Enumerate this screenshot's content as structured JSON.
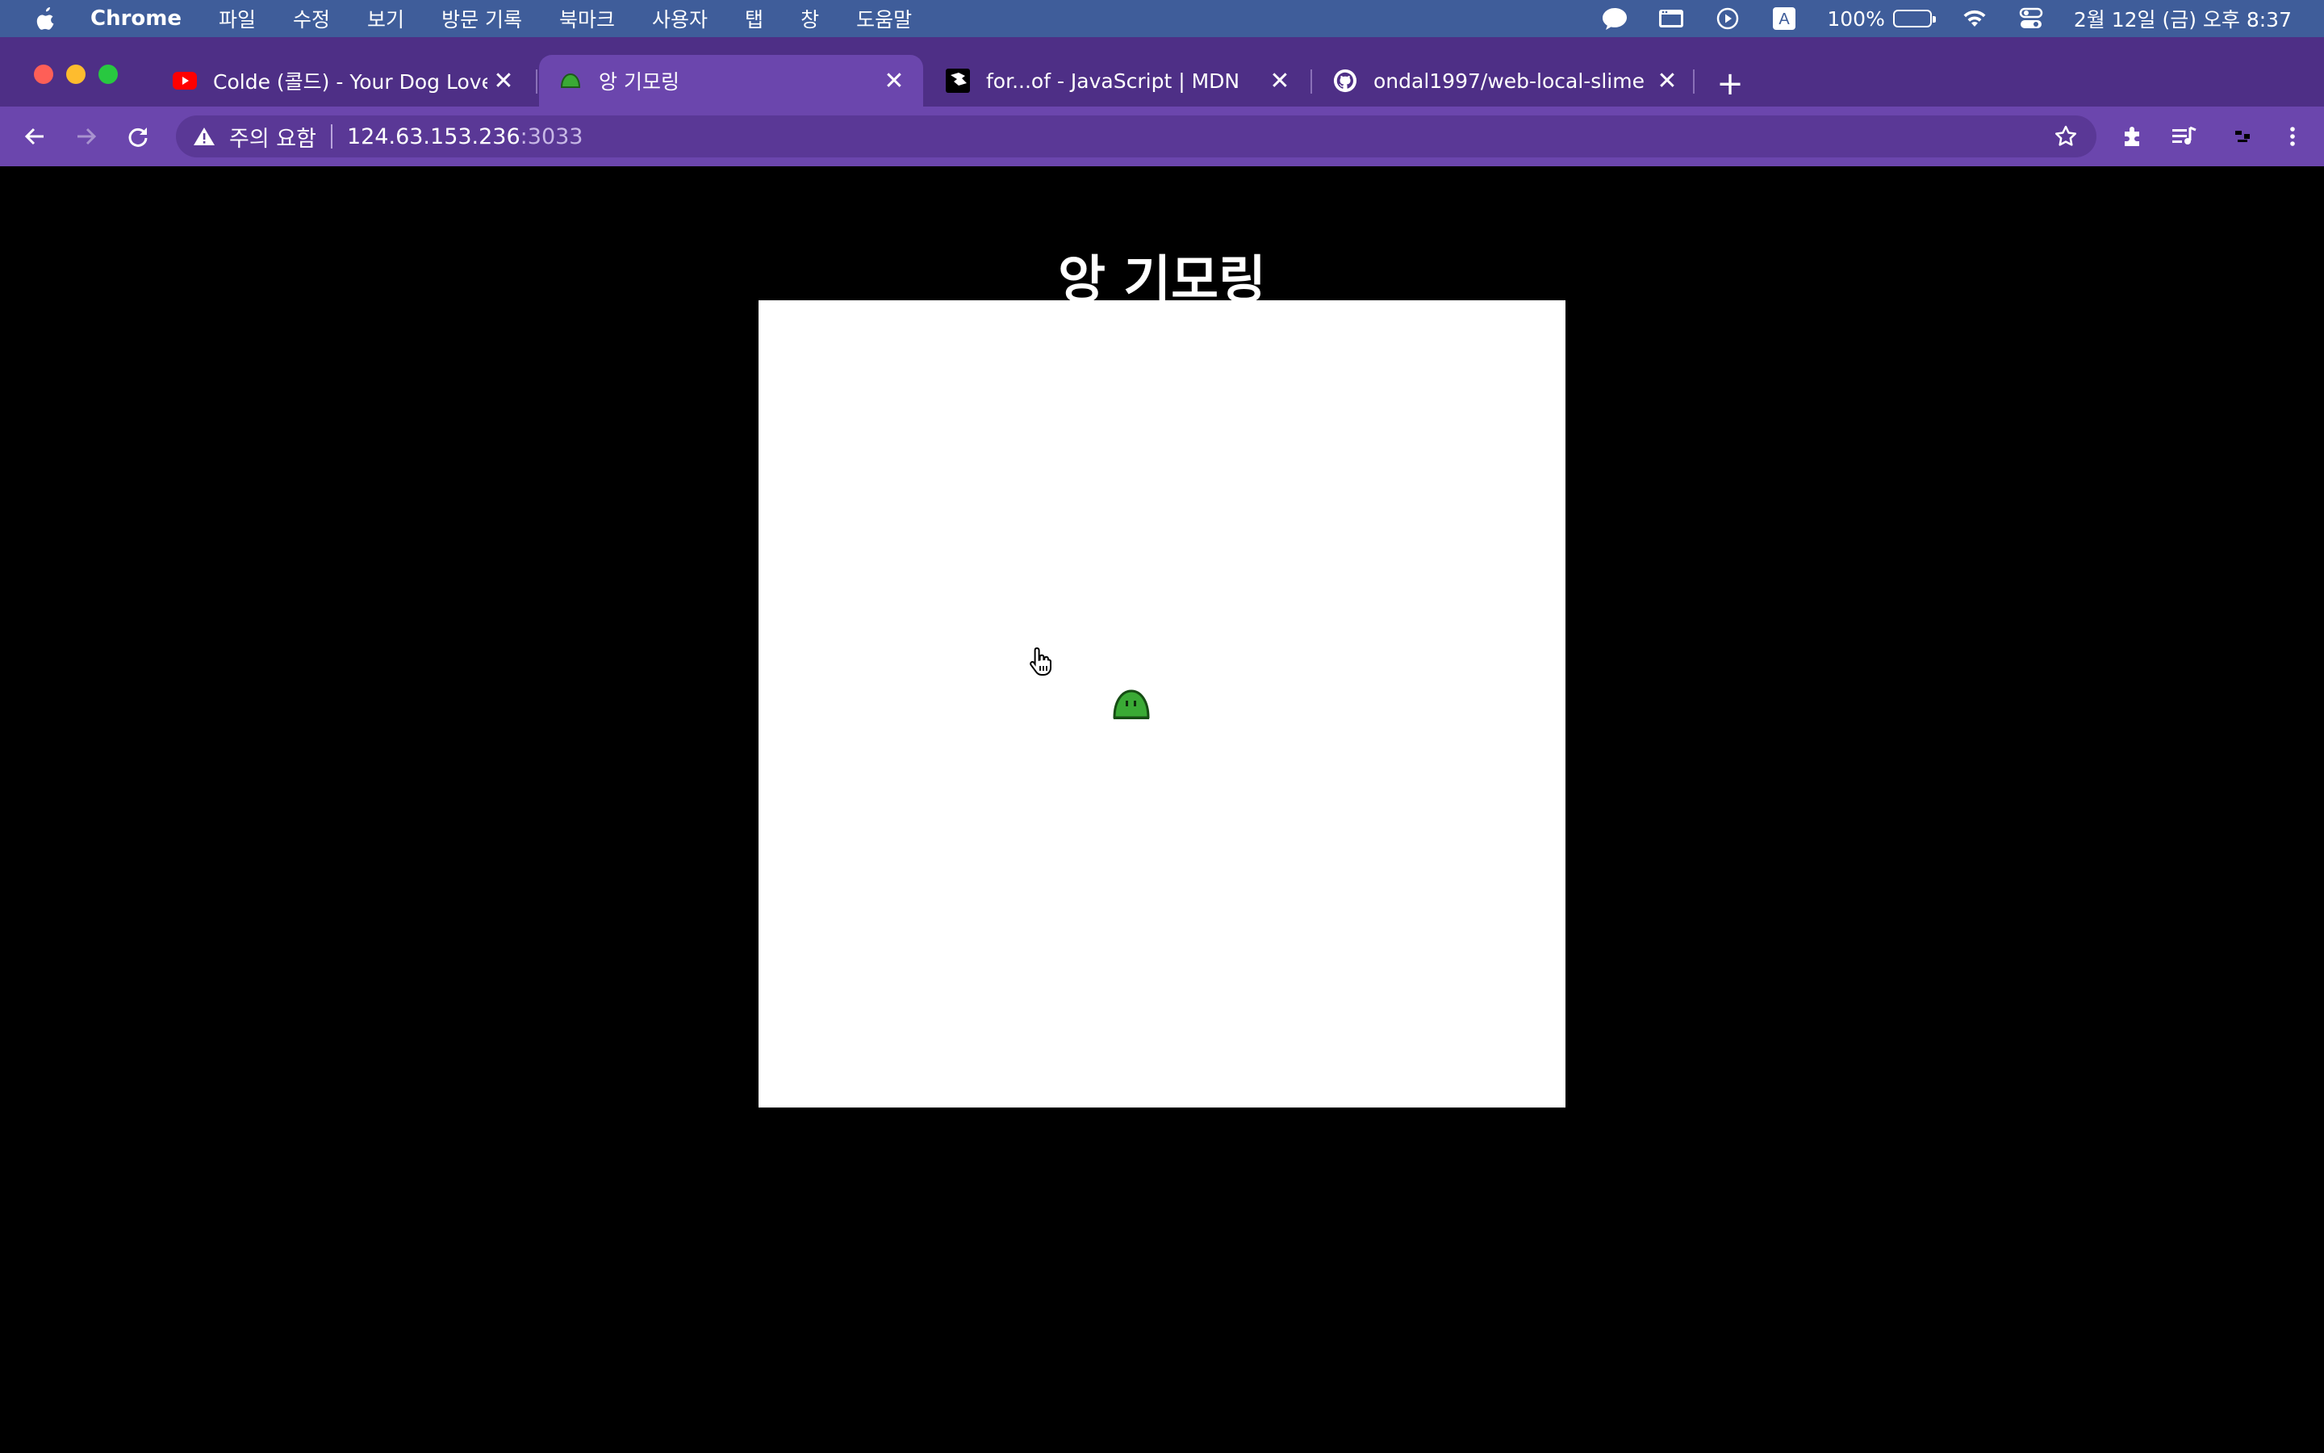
{
  "menubar": {
    "app_name": "Chrome",
    "menus": [
      "파일",
      "수정",
      "보기",
      "방문 기록",
      "북마크",
      "사용자",
      "탭",
      "창",
      "도움말"
    ],
    "battery_percent": "100%",
    "clock": "2월 12일 (금) 오후 8:37",
    "input_source": "A"
  },
  "tabs": [
    {
      "title": "Colde (콜드) - Your Dog Loves Y",
      "favicon": "youtube-icon",
      "active": false
    },
    {
      "title": "앙 기모링",
      "favicon": "slime-icon",
      "active": true
    },
    {
      "title": "for...of - JavaScript | MDN",
      "favicon": "mdn-icon",
      "active": false
    },
    {
      "title": "ondal1997/web-local-slime",
      "favicon": "github-icon",
      "active": false
    }
  ],
  "omnibox": {
    "security_label": "주의 요함",
    "host": "124.63.153.236",
    "port": ":3033"
  },
  "page": {
    "heading": "앙 기모링"
  },
  "colors": {
    "menubar": "#3f5d9a",
    "tabstrip": "#4e2f86",
    "toolbar": "#6b46ad",
    "slime": "#3aaa35"
  }
}
